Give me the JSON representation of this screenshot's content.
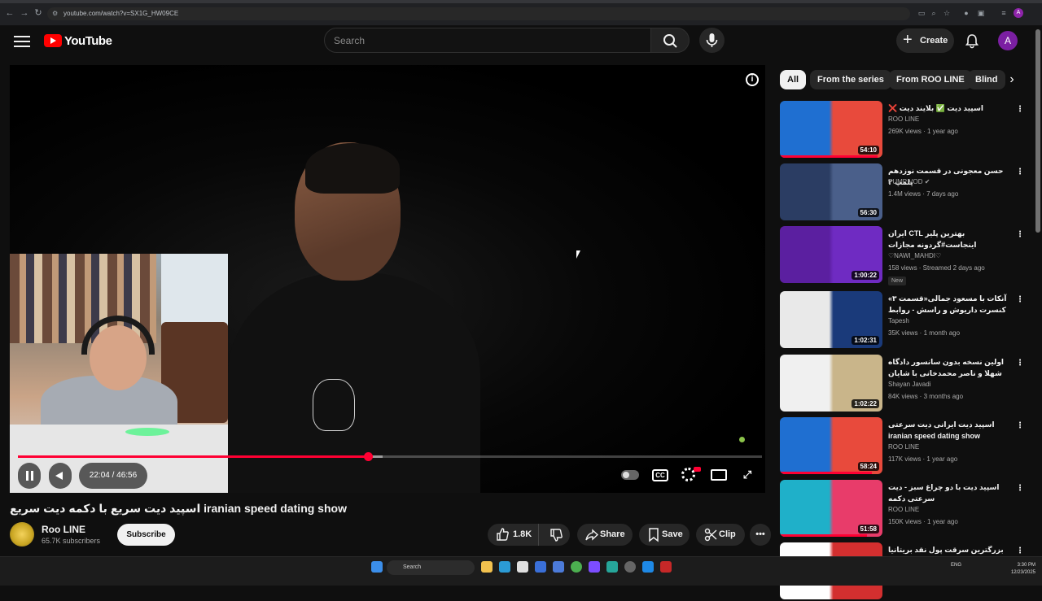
{
  "browser": {
    "url": "youtube.com/watch?v=SX1G_HW09CE",
    "profile_initial": "A"
  },
  "header": {
    "logo_text": "YouTube",
    "search_placeholder": "Search",
    "create_label": "Create",
    "avatar_initial": "A"
  },
  "player": {
    "time": "22:04 / 46:56",
    "progress_fraction": 0.47,
    "buffer_fraction": 0.49,
    "hd_badge": "HD",
    "cc_label": "CC"
  },
  "video": {
    "title": "اسپید دیت سریع با دکمه دیت سریع iranian speed dating show",
    "channel_name": "Roo LINE",
    "subscribers": "65.7K subscribers",
    "subscribe_label": "Subscribe",
    "likes": "1.8K",
    "share_label": "Share",
    "save_label": "Save",
    "clip_label": "Clip"
  },
  "chips": [
    "All",
    "From the series",
    "From ROO LINE",
    "Blind"
  ],
  "recommendations": [
    {
      "title": "اسپید دیت ✅ بلایند دیت ❌",
      "channel": "ROO LINE",
      "verified": false,
      "meta": "269K views · 1 year ago",
      "duration": "54:10",
      "progress_fraction": 0.95,
      "badge": "",
      "thumb_colors": [
        "#1f6fd1",
        "#e84a3c"
      ]
    },
    {
      "title": "حسن معجونی در قسمت نوزدهم پلمپ ۲",
      "channel": "PUMP VOD",
      "verified": true,
      "meta": "1.4M views · 7 days ago",
      "duration": "56:30",
      "progress_fraction": 0,
      "badge": "",
      "thumb_colors": [
        "#2b3d63",
        "#4a5f8a"
      ]
    },
    {
      "title": "بهترین پلیر CTL ایران اینجاست#گردونه مجازات #Live_Stream🔴",
      "channel": "♡NAWI_MAHDI♡",
      "verified": false,
      "meta": "158 views · Streamed 2 days ago",
      "duration": "1:00:22",
      "progress_fraction": 0,
      "badge": "New",
      "thumb_colors": [
        "#5b1fa0",
        "#6f2bc2"
      ]
    },
    {
      "title": "آنکات با مسعود جمالی«قسمت ۳» کنسرت داریوش و راسش - روابط خوانندگان با ...",
      "channel": "Tapesh",
      "verified": false,
      "meta": "35K views · 1 month ago",
      "duration": "1:02:31",
      "progress_fraction": 0,
      "badge": "",
      "thumb_colors": [
        "#e9e9e9",
        "#1a3a7a"
      ]
    },
    {
      "title": "اولین نسخه بدون سانسور دادگاه شهلا و ناصر محمدخانی با شایان #مستند #جنایی ...",
      "channel": "Shayan Javadi",
      "verified": false,
      "meta": "84K views · 3 months ago",
      "duration": "1:02:22",
      "progress_fraction": 0,
      "badge": "",
      "thumb_colors": [
        "#f0f0f0",
        "#c9b58a"
      ]
    },
    {
      "title": "اسپید دیت ایرانی دیت سرعتی iranian speed dating show",
      "channel": "ROO LINE",
      "verified": false,
      "meta": "117K views · 1 year ago",
      "duration": "58:24",
      "progress_fraction": 0.9,
      "badge": "",
      "thumb_colors": [
        "#1f6fd1",
        "#e84a3c"
      ]
    },
    {
      "title": "اسپید دیت با دو چراغ سبز - دیت سرعتی دکمه",
      "channel": "ROO LINE",
      "verified": false,
      "meta": "150K views · 1 year ago",
      "duration": "51:58",
      "progress_fraction": 0.85,
      "badge": "",
      "thumb_colors": [
        "#1fb0c9",
        "#e83c6a"
      ]
    },
    {
      "title": "بزرگترین سرقت پول نقد بریتانیا چگونه",
      "channel": "",
      "verified": false,
      "meta": "",
      "duration": "",
      "progress_fraction": 0,
      "badge": "",
      "thumb_colors": [
        "#ffffff",
        "#d32f2f"
      ]
    }
  ],
  "taskbar": {
    "search_label": "Search",
    "lang": "ENG",
    "time": "3:30 PM",
    "date": "12/23/2025"
  },
  "colors": {
    "accent": "#ff0033",
    "background": "#0f0f0f",
    "chip_bg": "#272727"
  }
}
